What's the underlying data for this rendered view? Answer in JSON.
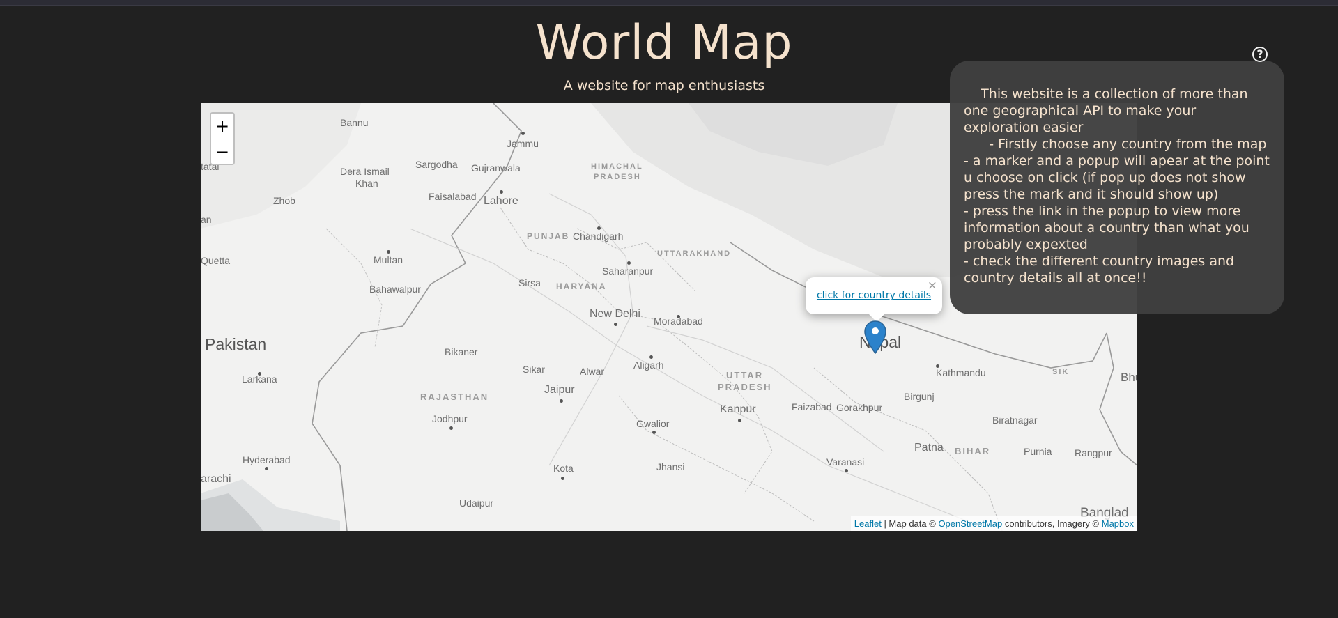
{
  "header": {
    "title": "World Map",
    "subtitle": "A website for map enthusiasts"
  },
  "map": {
    "zoom_in_label": "+",
    "zoom_out_label": "−",
    "popup": {
      "link_text": "click for country details",
      "close_label": "×"
    },
    "marker_icon": "map-pin-icon",
    "attribution": {
      "leaflet": "Leaflet",
      "map_data": " | Map data © ",
      "osm": "OpenStreetMap",
      "imagery": " contributors, Imagery © ",
      "mapbox": "Mapbox"
    },
    "labels": {
      "bannu": "Bannu",
      "jammu": "Jammu",
      "sargodha": "Sargodha",
      "gujranwala": "Gujranwala",
      "dera_ismail_khan_1": "Dera Ismail",
      "dera_ismail_khan_2": "Khan",
      "himachal_1": "HIMACHAL",
      "himachal_2": "PRADESH",
      "zhob": "Zhob",
      "faisalabad": "Faisalabad",
      "lahore": "Lahore",
      "punjab": "PUNJAB",
      "chandigarh": "Chandigarh",
      "uttarakhand": "UTTARAKHAND",
      "quetta": "Quetta",
      "multan": "Multan",
      "saharanpur": "Saharanpur",
      "sirsa": "Sirsa",
      "haryana": "HARYANA",
      "bahawalpur": "Bahawalpur",
      "new_delhi": "New Delhi",
      "moradabad": "Moradabad",
      "pakistan": "Pakistan",
      "bikaner": "Bikaner",
      "nepal": "Nepal",
      "aligarh": "Aligarh",
      "sikar": "Sikar",
      "alwar": "Alwar",
      "kathmandu": "Kathmandu",
      "larkana": "Larkana",
      "uttar_1": "UTTAR",
      "uttar_2": "PRADESH",
      "sik": "SIK",
      "bhu": "Bhu",
      "jaipur": "Jaipur",
      "rajasthan": "RAJASTHAN",
      "birgunj": "Birgunj",
      "faizabad": "Faizabad",
      "gorakhpur": "Gorakhpur",
      "kanpur": "Kanpur",
      "jodhpur": "Jodhpur",
      "gwalior": "Gwalior",
      "biratnagar": "Biratnagar",
      "patna": "Patna",
      "bihar": "BIHAR",
      "purnia": "Purnia",
      "rangpur": "Rangpur",
      "hyderabad": "Hyderabad",
      "varanasi": "Varanasi",
      "jhansi": "Jhansi",
      "kota": "Kota",
      "karachi": "arachi",
      "udaipur": "Udaipur",
      "bangladesh": "Banglad",
      "an": "an",
      "tatai": "tatai"
    }
  },
  "help": {
    "icon": "question-circle-icon",
    "label": "?",
    "lines": [
      "    This website is a collection of more than one geographical API to make your exploration easier",
      "      - Firstly choose any country from the map",
      "- a marker and a popup will apear at the point u choose on click (if pop up does not show press the mark and it should show up)",
      "- press the link in the popup to view more information about a country than what you probably expexted",
      "- check the different country images and country details all at once!!"
    ]
  }
}
